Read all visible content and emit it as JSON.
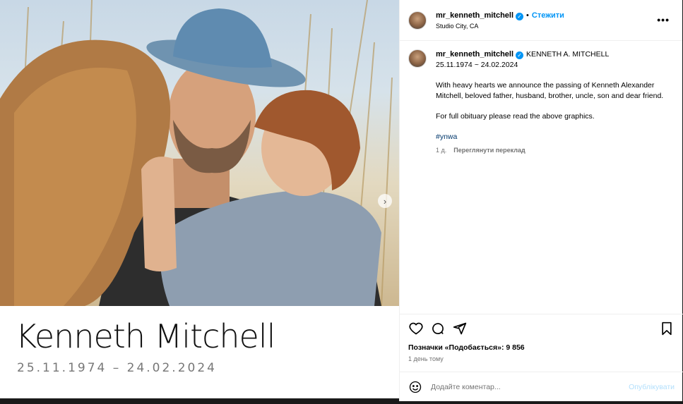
{
  "post": {
    "username": "mr_kenneth_mitchell",
    "follow_label": "Стежити",
    "dot": "•",
    "location": "Studio City, CA",
    "more_label": "•••"
  },
  "media": {
    "overlay_name": "Kenneth Mitchell",
    "overlay_dates": "25.11.1974 – 24.02.2024",
    "next_label": "›"
  },
  "caption": {
    "username": "mr_kenneth_mitchell",
    "title": "KENNETH A. MITCHELL",
    "dates": "25.11.1974 ~ 24.02.2024",
    "paragraph1": "With heavy hearts we announce the passing of Kenneth Alexander Mitchell, beloved father, husband, brother, uncle, son and dear friend.",
    "paragraph2": "For full obituary please read the above graphics.",
    "hashtag": "#ynwa",
    "age": "1 д.",
    "translate_label": "Переглянути переклад"
  },
  "actions": {
    "icons": [
      "heart-icon",
      "comment-icon",
      "share-icon",
      "bookmark-icon"
    ],
    "likes_text": "Позначки «Подобається»: 9 856",
    "time_text": "1 день тому"
  },
  "comment_box": {
    "placeholder": "Додайте коментар...",
    "publish_label": "Опублікувати"
  },
  "colors": {
    "accent": "#0095f6",
    "hashtag": "#00376b",
    "muted": "#737373",
    "publish_disabled": "#b2dffc"
  }
}
